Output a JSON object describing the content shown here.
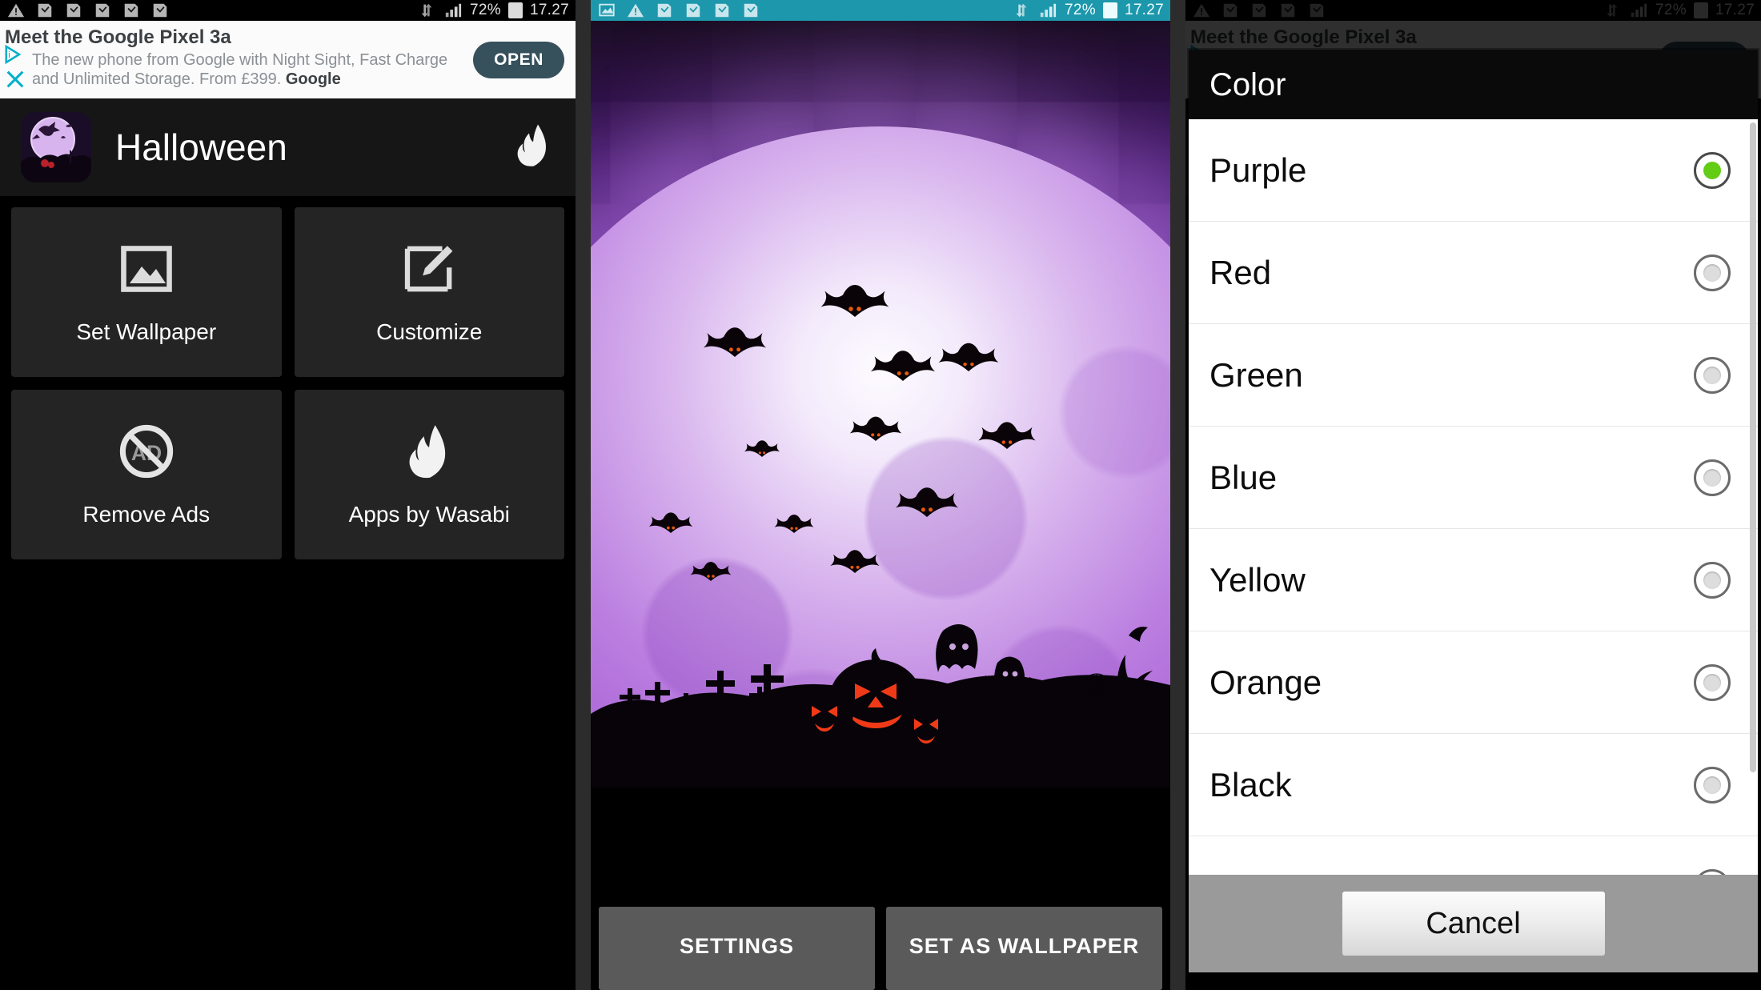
{
  "status_bar": {
    "battery_percent": "72%",
    "time": "17.27",
    "icons": [
      "warning-icon",
      "download-icon",
      "download-icon",
      "download-icon",
      "download-icon",
      "download-icon",
      "data-transfer-icon",
      "signal-icon",
      "battery-icon"
    ],
    "screenshot_icon": "screenshot-icon"
  },
  "ad": {
    "title": "Meet the Google Pixel 3a",
    "line1": "The new phone from Google with Night Sight, Fast Charge",
    "line2": "and Unlimited Storage. From £399.",
    "advertiser": "Google",
    "open_label": "OPEN",
    "adchoices_icon": "adchoices-icon",
    "close_icon": "close-icon",
    "accent_color": "#00b0c8",
    "button_color": "#36505c"
  },
  "app": {
    "title": "Halloween",
    "icon_name": "halloween-app-icon",
    "brand_icon": "wasabi-flame-icon"
  },
  "tiles": [
    {
      "label": "Set Wallpaper",
      "icon": "image-icon"
    },
    {
      "label": "Customize",
      "icon": "brush-icon"
    },
    {
      "label": "Remove Ads",
      "icon": "no-ads-icon"
    },
    {
      "label": "Apps by Wasabi",
      "icon": "wasabi-flame-icon"
    }
  ],
  "preview": {
    "scene": "purple-moon-bats-graveyard",
    "settings_label": "SETTINGS",
    "set_wallpaper_label": "SET AS WALLPAPER"
  },
  "dialog": {
    "title": "Color",
    "selected": "Purple",
    "cancel_label": "Cancel",
    "selected_radio_color": "#63cc15",
    "options": [
      {
        "label": "Purple",
        "selected": true
      },
      {
        "label": "Red",
        "selected": false
      },
      {
        "label": "Green",
        "selected": false
      },
      {
        "label": "Blue",
        "selected": false
      },
      {
        "label": "Yellow",
        "selected": false
      },
      {
        "label": "Orange",
        "selected": false
      },
      {
        "label": "Black",
        "selected": false
      }
    ]
  }
}
